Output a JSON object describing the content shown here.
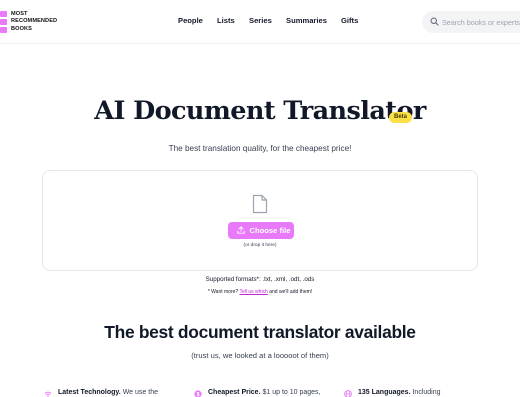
{
  "logo": {
    "line1": "MOST",
    "line2": "RECOMMENDED",
    "line3": "BOOKS"
  },
  "nav": {
    "items": [
      "People",
      "Lists",
      "Series",
      "Summaries",
      "Gifts"
    ]
  },
  "search": {
    "placeholder": "Search books or experts"
  },
  "hero": {
    "title": "AI Document Translator",
    "badge": "Beta",
    "subtitle": "The best translation quality, for the cheapest price!"
  },
  "upload": {
    "button_label": "Choose file",
    "drop_hint": "(or drop it here)",
    "formats": "Supported formats*: .txt, .xml, .odt, .ods",
    "want_more_prefix": "* Want more? ",
    "want_more_link": "Tell us which",
    "want_more_suffix": " and we'll add them!"
  },
  "section": {
    "title": "The best document translator available",
    "subtitle": "(trust us, we looked at a looooot of them)"
  },
  "features": [
    {
      "bold": "Latest Technology.",
      "text": " We use the",
      "icon": "wifi-icon"
    },
    {
      "bold": "Cheapest Price.",
      "text": " $1 up to 10 pages,",
      "icon": "dollar-icon"
    },
    {
      "bold": "135 Languages.",
      "text": " Including",
      "icon": "globe-icon"
    }
  ],
  "colors": {
    "accent": "#e879f9",
    "badge": "#fde047",
    "text": "#111827"
  }
}
